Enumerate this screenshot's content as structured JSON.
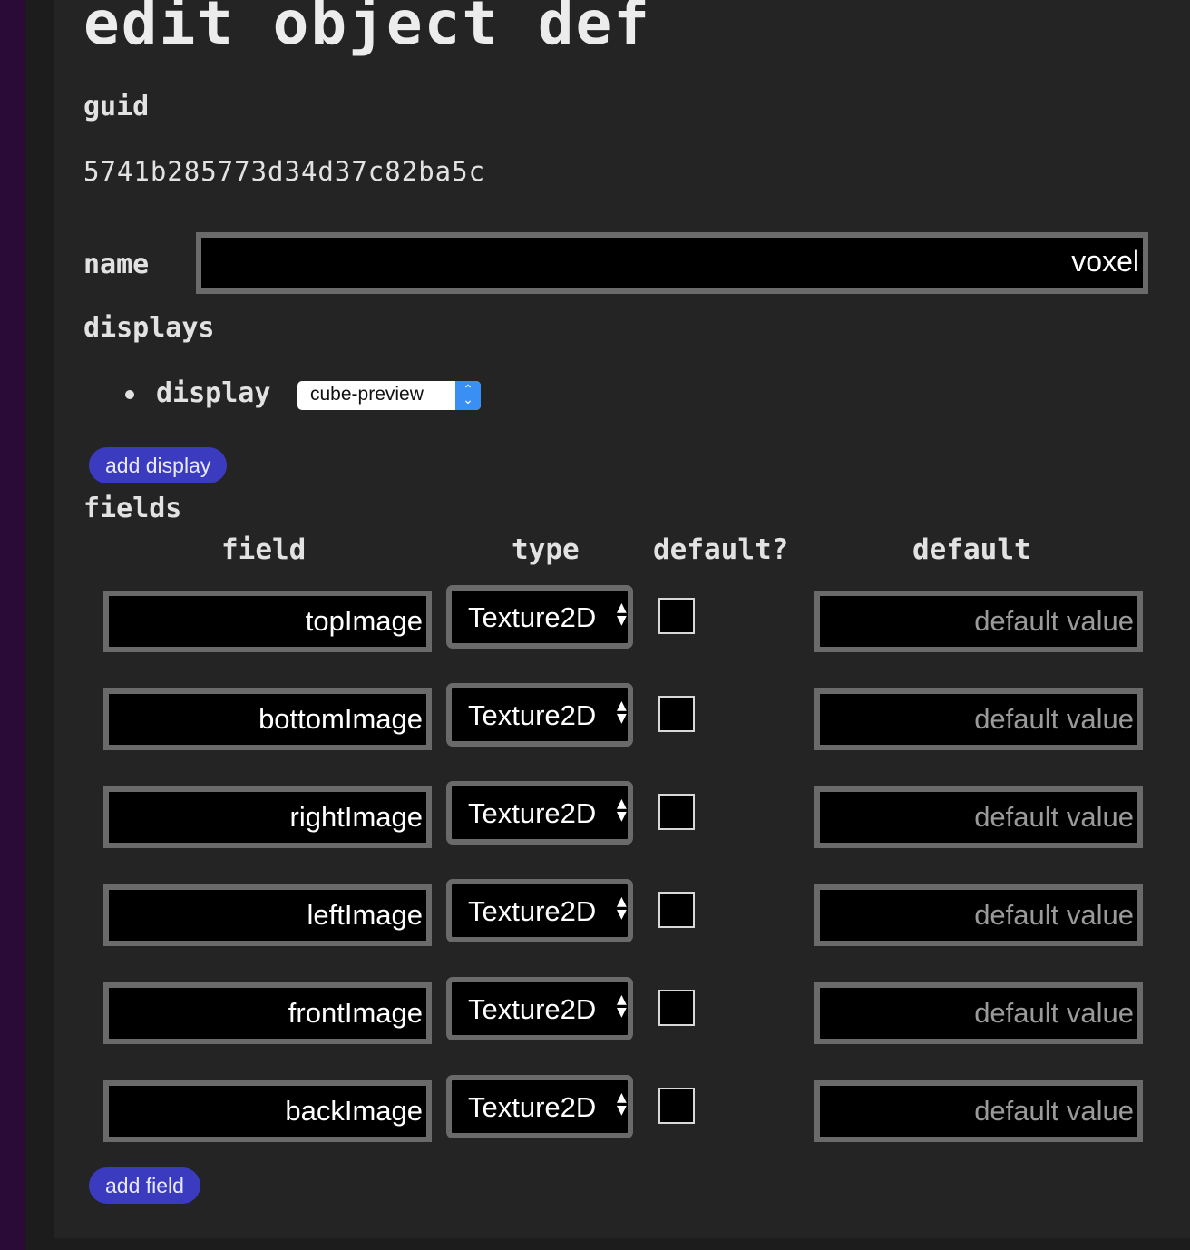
{
  "page": {
    "title": "edit object def"
  },
  "guid": {
    "label": "guid",
    "value": "5741b285773d34d37c82ba5c"
  },
  "name": {
    "label": "name",
    "value": "voxel"
  },
  "displays": {
    "label": "displays",
    "items": [
      {
        "label": "display",
        "selected": "cube-preview"
      }
    ],
    "add_label": "add display"
  },
  "fields": {
    "label": "fields",
    "columns": [
      "field",
      "type",
      "default?",
      "default"
    ],
    "rows": [
      {
        "name": "topImage",
        "type": "Texture2D",
        "has_default": false,
        "default_placeholder": "default value"
      },
      {
        "name": "bottomImage",
        "type": "Texture2D",
        "has_default": false,
        "default_placeholder": "default value"
      },
      {
        "name": "rightImage",
        "type": "Texture2D",
        "has_default": false,
        "default_placeholder": "default value"
      },
      {
        "name": "leftImage",
        "type": "Texture2D",
        "has_default": false,
        "default_placeholder": "default value"
      },
      {
        "name": "frontImage",
        "type": "Texture2D",
        "has_default": false,
        "default_placeholder": "default value"
      },
      {
        "name": "backImage",
        "type": "Texture2D",
        "has_default": false,
        "default_placeholder": "default value"
      }
    ],
    "add_label": "add field"
  },
  "colors": {
    "button_bg": "#3b3bbf",
    "panel_bg": "#242424",
    "input_bg": "#000000",
    "input_border": "#6a6a6a",
    "select_accent": "#3a8ff5"
  },
  "icons": {
    "select_arrows": "up-down-chevron-icon",
    "bullet": "bullet-icon"
  }
}
